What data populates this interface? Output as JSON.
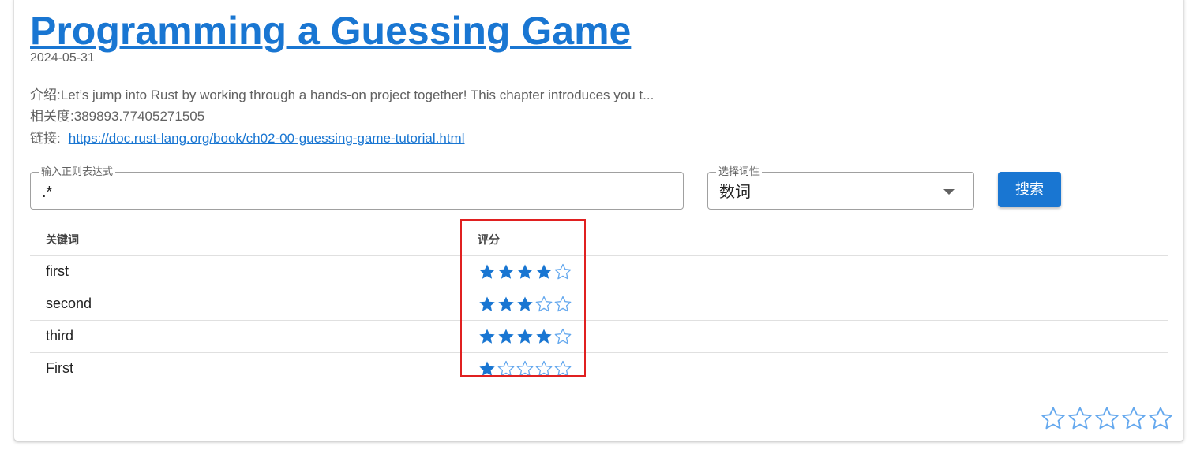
{
  "article": {
    "title": "Programming a Guessing Game",
    "date": "2024-05-31",
    "intro_label": "介绍:",
    "intro_text": "Let’s jump into Rust by working through a hands-on project together! This chapter introduces you t...",
    "relevance_label": "相关度:",
    "relevance_value": "389893.77405271505",
    "link_label": "链接:",
    "link_url": "https://doc.rust-lang.org/book/ch02-00-guessing-game-tutorial.html"
  },
  "search": {
    "regex_label": "输入正则表达式",
    "regex_value": ".*",
    "pos_label": "选择词性",
    "pos_value": "数词",
    "button_label": "搜索"
  },
  "table": {
    "columns": [
      "关键词",
      "评分"
    ],
    "rows": [
      {
        "keyword": "first",
        "rating": 4
      },
      {
        "keyword": "second",
        "rating": 3
      },
      {
        "keyword": "third",
        "rating": 4
      },
      {
        "keyword": "First",
        "rating": 1
      }
    ],
    "rating_max": 5
  },
  "page_rating": {
    "value": 0,
    "max": 5
  },
  "colors": {
    "accent": "#1976d2",
    "star_filled": "#1976d2",
    "star_empty": "#64a8ee",
    "highlight": "#e02020"
  },
  "icons": {
    "filled_star": "star-filled-icon",
    "empty_star": "star-outline-icon",
    "dropdown": "caret-down-icon"
  }
}
